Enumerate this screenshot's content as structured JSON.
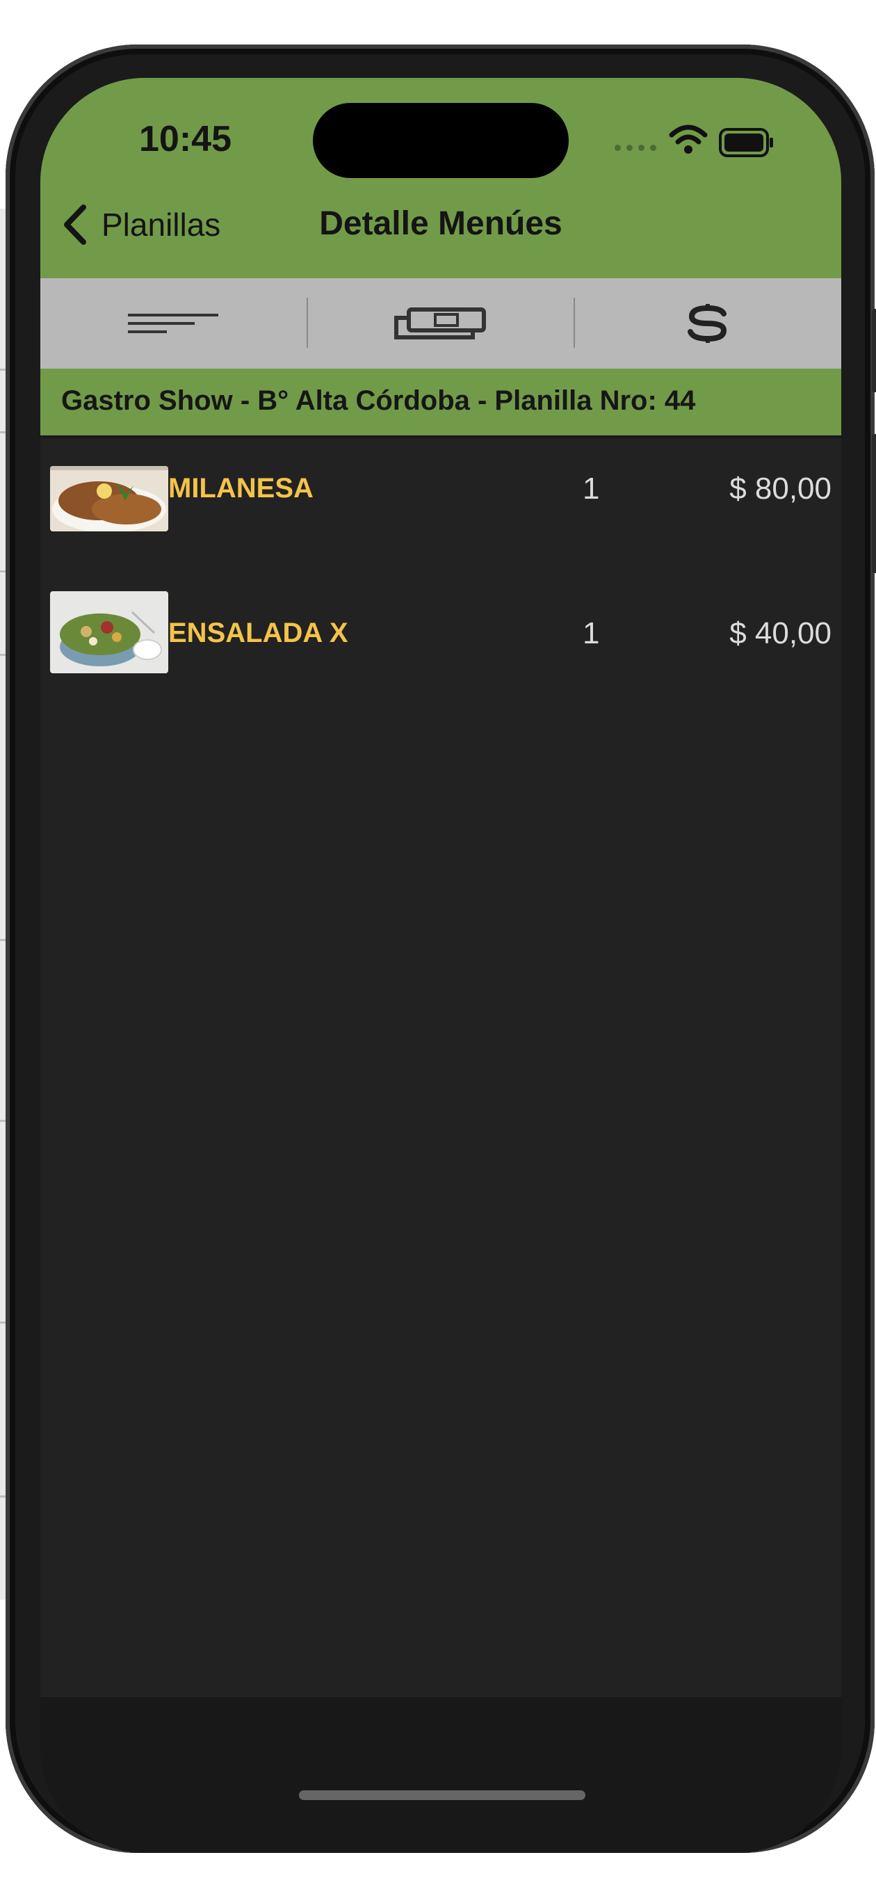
{
  "status_bar": {
    "time": "10:45"
  },
  "nav": {
    "back_label": "Planillas",
    "title": "Detalle Menúes"
  },
  "toolbar": {
    "items": [
      {
        "icon": "sort-lines-icon"
      },
      {
        "icon": "money-bills-icon"
      },
      {
        "icon": "dollar-sign-icon"
      }
    ]
  },
  "info": {
    "text": "Gastro Show - B° Alta Córdoba - Planilla Nro: 44"
  },
  "menu_items": [
    {
      "name": "MILANESA",
      "qty": "1",
      "price": "$ 80,00",
      "image": "milanesa-photo"
    },
    {
      "name": "ENSALADA X",
      "qty": "1",
      "price": "$ 40,00",
      "image": "salad-photo"
    }
  ],
  "colors": {
    "header_green": "#729b49",
    "toolbar_gray": "#b8b8b8",
    "list_bg": "#222222",
    "item_name": "#f3c34a",
    "item_value": "#dcdcdc"
  }
}
